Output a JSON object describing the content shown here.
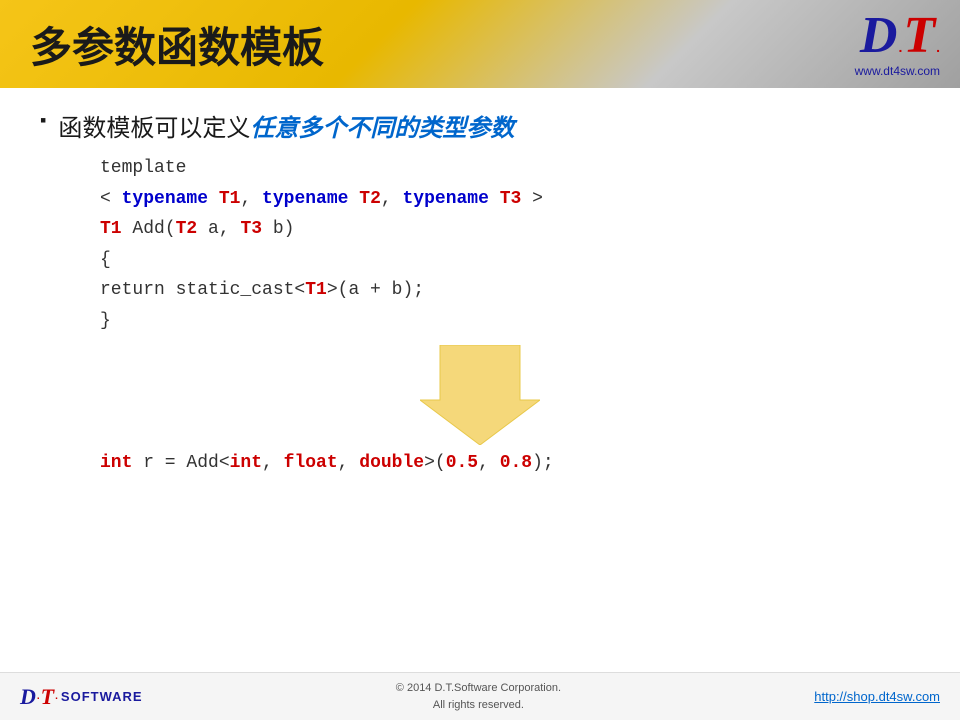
{
  "header": {
    "title": "多参数函数模板",
    "logo": {
      "d": "D",
      "t": "T",
      "url": "www.dt4sw.com"
    }
  },
  "bullet": {
    "marker": "▪",
    "text_normal": "函数模板可以定义",
    "text_highlight": "任意多个不同的类型参数"
  },
  "code": {
    "line1": "template",
    "line2_lt": "< ",
    "line2_kw1": "typename",
    "line2_t1": " T1,",
    "line2_kw2": " typename",
    "line2_t2": " T2,",
    "line2_kw3": " typename",
    "line2_t3": " T3",
    "line2_gt": " >",
    "line3_t1": "T1",
    "line3_rest": " Add(",
    "line3_t2": "T2",
    "line3_a": " a, ",
    "line3_t3": "T3",
    "line3_b": " b)",
    "line4": "{",
    "line5_return": "    return static_cast<",
    "line5_t1": "T1",
    "line5_rest": ">(a + b);",
    "line6": "}"
  },
  "bottom_code": {
    "kw_int": "int",
    "rest1": " r = Add<",
    "kw_int2": "int",
    "rest2": ", ",
    "kw_float": "float",
    "rest3": ", ",
    "kw_double": "double",
    "rest4": ">(",
    "val1": "0.5",
    "sep": ", ",
    "val2": "0.8",
    "end": ");"
  },
  "footer": {
    "logo": {
      "d": "D",
      "dot1": ".",
      "t": "T",
      "dot2": ".",
      "software": "Software"
    },
    "copyright": "© 2014 D.T.Software Corporation.",
    "rights": "All rights reserved.",
    "link": "http://shop.dt4sw.com"
  }
}
